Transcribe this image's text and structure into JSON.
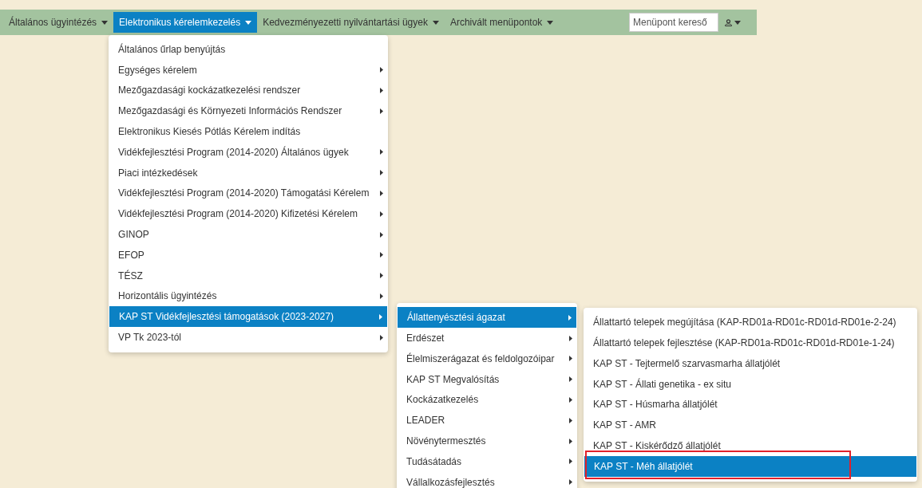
{
  "navbar": {
    "items": [
      {
        "label": "Általános ügyintézés",
        "selected": false
      },
      {
        "label": "Elektronikus kérelemkezelés",
        "selected": true,
        "menu": [
          {
            "label": "Általános űrlap benyújtás",
            "has_submenu": false,
            "selected": false
          },
          {
            "label": "Egységes kérelem",
            "has_submenu": true,
            "selected": false
          },
          {
            "label": "Mezőgazdasági kockázatkezelési rendszer",
            "has_submenu": true,
            "selected": false
          },
          {
            "label": "Mezőgazdasági és Környezeti Információs Rendszer",
            "has_submenu": true,
            "selected": false
          },
          {
            "label": "Elektronikus Kiesés Pótlás Kérelem indítás",
            "has_submenu": false,
            "selected": false
          },
          {
            "label": "Vidékfejlesztési Program (2014-2020) Általános ügyek",
            "has_submenu": true,
            "selected": false
          },
          {
            "label": "Piaci intézkedések",
            "has_submenu": true,
            "selected": false
          },
          {
            "label": "Vidékfejlesztési Program (2014-2020) Támogatási Kérelem",
            "has_submenu": true,
            "selected": false
          },
          {
            "label": "Vidékfejlesztési Program (2014-2020) Kifizetési Kérelem",
            "has_submenu": true,
            "selected": false
          },
          {
            "label": "GINOP",
            "has_submenu": true,
            "selected": false
          },
          {
            "label": "EFOP",
            "has_submenu": true,
            "selected": false
          },
          {
            "label": "TÉSZ",
            "has_submenu": true,
            "selected": false
          },
          {
            "label": "Horizontális ügyintézés",
            "has_submenu": true,
            "selected": false
          },
          {
            "label": "KAP ST Vidékfejlesztési támogatások (2023-2027)",
            "has_submenu": true,
            "selected": true,
            "children": [
              {
                "label": "Állattenyésztési ágazat",
                "has_submenu": true,
                "selected": true,
                "children": [
                  {
                    "label": "Állattartó telepek megújítása (KAP-RD01a-RD01c-RD01d-RD01e-2-24)",
                    "has_submenu": false,
                    "selected": false
                  },
                  {
                    "label": "Állattartó telepek fejlesztése (KAP-RD01a-RD01c-RD01d-RD01e-1-24)",
                    "has_submenu": false,
                    "selected": false
                  },
                  {
                    "label": "KAP ST - Tejtermelő szarvasmarha állatjólét",
                    "has_submenu": false,
                    "selected": false
                  },
                  {
                    "label": "KAP ST - Állati genetika - ex situ",
                    "has_submenu": false,
                    "selected": false
                  },
                  {
                    "label": "KAP ST - Húsmarha állatjólét",
                    "has_submenu": false,
                    "selected": false
                  },
                  {
                    "label": "KAP ST - AMR",
                    "has_submenu": false,
                    "selected": false
                  },
                  {
                    "label": "KAP ST - Kiskérődző állatjólét",
                    "has_submenu": false,
                    "selected": false
                  },
                  {
                    "label": "KAP ST - Méh állatjólét",
                    "has_submenu": false,
                    "selected": true,
                    "highlighted": true
                  }
                ]
              },
              {
                "label": "Erdészet",
                "has_submenu": true,
                "selected": false
              },
              {
                "label": "Élelmiszerágazat és feldolgozóipar",
                "has_submenu": true,
                "selected": false
              },
              {
                "label": "KAP ST Megvalósítás",
                "has_submenu": true,
                "selected": false
              },
              {
                "label": "Kockázatkezelés",
                "has_submenu": true,
                "selected": false
              },
              {
                "label": "LEADER",
                "has_submenu": true,
                "selected": false
              },
              {
                "label": "Növénytermesztés",
                "has_submenu": true,
                "selected": false
              },
              {
                "label": "Tudásátadás",
                "has_submenu": true,
                "selected": false
              },
              {
                "label": "Vállalkozásfejlesztés",
                "has_submenu": true,
                "selected": false
              }
            ]
          },
          {
            "label": "VP Tk 2023-tól",
            "has_submenu": true,
            "selected": false
          }
        ]
      },
      {
        "label": "Kedvezményezetti nyilvántartási ügyek",
        "selected": false
      },
      {
        "label": "Archivált menüpontok",
        "selected": false
      }
    ],
    "search": {
      "placeholder": "Menüpont kereső"
    }
  }
}
